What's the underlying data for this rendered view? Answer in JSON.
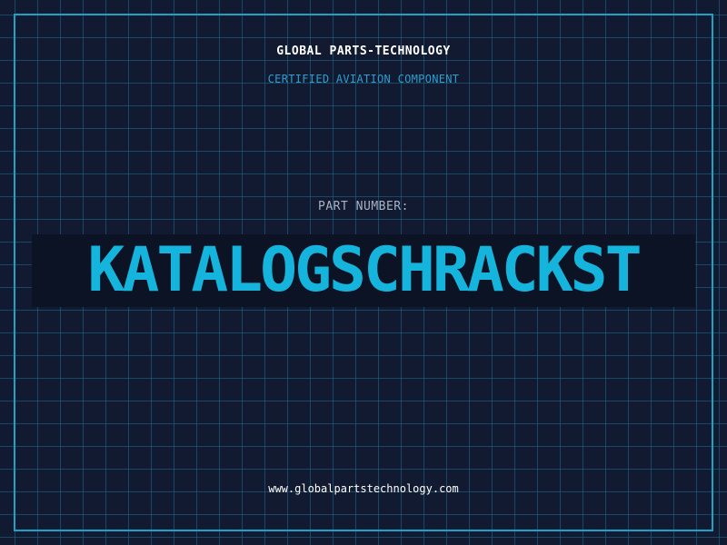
{
  "header": {
    "brand": "GLOBAL PARTS-TECHNOLOGY",
    "tagline": "CERTIFIED AVIATION COMPONENT"
  },
  "part": {
    "label": "PART NUMBER:",
    "number": "KATALOGSCHRACKST"
  },
  "footer": {
    "website": "www.globalpartstechnology.com"
  },
  "colors": {
    "background": "#111a30",
    "grid": "#1e6e8c",
    "frame": "#1aa3c8",
    "accent": "#14b4dc",
    "tagline": "#2a9fd0",
    "label": "#aab3c4"
  }
}
